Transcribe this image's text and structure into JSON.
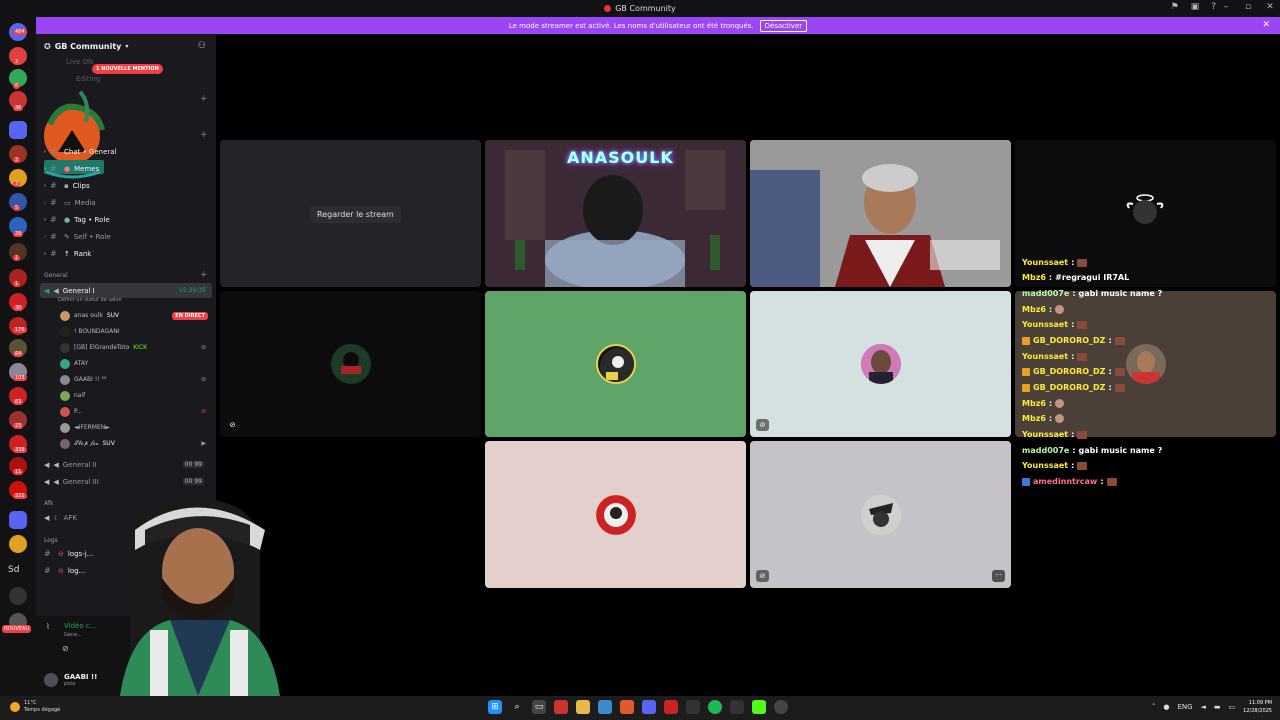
{
  "window": {
    "title": "GB Community"
  },
  "banner": {
    "message": "Le mode streamer est activé. Les noms d'utilisateur ont été tronqués.",
    "button": "Désactiver"
  },
  "rail": {
    "badges": [
      "484",
      "2",
      "6",
      "36",
      "2",
      "3",
      "5",
      "29",
      "1",
      "1",
      "30",
      "176",
      "64",
      "103",
      "63",
      "23",
      "338",
      "11",
      "221"
    ],
    "sd_label": "Sd",
    "nouveau_label": "NOUVEAU"
  },
  "server": {
    "name": "GB Community",
    "mention_label": "1 NOUVELLE MENTION",
    "hidden_channels": [
      "Live ON",
      "Editing"
    ]
  },
  "channels": [
    {
      "label": "Chat • General",
      "icon": "#"
    },
    {
      "label": "Memes",
      "icon": "#"
    },
    {
      "label": "Clips",
      "icon": "#"
    },
    {
      "label": "Media",
      "icon": "#"
    },
    {
      "label": "Tag • Role",
      "icon": "#"
    },
    {
      "label": "Self • Role",
      "icon": "#"
    },
    {
      "label": "Rank",
      "icon": "#"
    }
  ],
  "categories": {
    "general": "General",
    "afk": "Afk",
    "logs": "Logs"
  },
  "voice": {
    "general1": {
      "label": "General I",
      "time": "15:29:35",
      "status": "Définir un statut de salon"
    },
    "users": [
      {
        "name": "anas oulk",
        "tag": "SUV",
        "live": "EN DIRECT"
      },
      {
        "name": "! BOUNDAGANI",
        "tag": ""
      },
      {
        "name": "[GB] ElGrandeToto",
        "tag": "KICK"
      },
      {
        "name": "ATAY",
        "tag": ""
      },
      {
        "name": "GAABI !! ²⁵",
        "tag": ""
      },
      {
        "name": "naif",
        "tag": ""
      },
      {
        "name": "P...",
        "tag": ""
      },
      {
        "name": "◄IFERMEN►",
        "tag": ""
      },
      {
        "name": "𝓢𝓽𝓸𝓹 𝓯𝓲𝔁",
        "tag": "SUV"
      }
    ],
    "general2": {
      "label": "General II",
      "count_a": "00",
      "count_b": "99"
    },
    "general3": {
      "label": "General III",
      "count_a": "00",
      "count_b": "99"
    },
    "afk": {
      "label": "AFK"
    },
    "logs": [
      "logs-j...",
      "log..."
    ]
  },
  "voice_connected": {
    "title": "Vidéo c...",
    "subtitle": "Gene..."
  },
  "user_panel": {
    "name": "GAABI !!",
    "status": "poto"
  },
  "stage": {
    "watch_label": "Regarder le stream",
    "stream_name": "ANASOULK"
  },
  "chat": [
    {
      "user": "Mbz6",
      "text": "#regragui IR7AL",
      "class": "u"
    },
    {
      "user": "madd007e",
      "text": "gabi music name ?",
      "class": "u2"
    },
    {
      "user": "Mbz6",
      "text": "",
      "class": "u"
    },
    {
      "user": "Younssaet",
      "text": "",
      "class": "u"
    },
    {
      "user": "GB_DORORO_DZ",
      "text": "",
      "class": "u"
    },
    {
      "user": "Younssaet",
      "text": "",
      "class": "u"
    },
    {
      "user": "GB_DORORO_DZ",
      "text": "",
      "class": "u"
    },
    {
      "user": "GB_DORORO_DZ",
      "text": "",
      "class": "u"
    },
    {
      "user": "Mbz6",
      "text": "",
      "class": "u"
    },
    {
      "user": "Mbz6",
      "text": "",
      "class": "u"
    },
    {
      "user": "Younssaet",
      "text": "",
      "class": "u"
    },
    {
      "user": "madd007e",
      "text": "gabi music name ?",
      "class": "u2"
    },
    {
      "user": "Younssaet",
      "text": "",
      "class": "u"
    },
    {
      "user": "amedinntrcaw",
      "text": "",
      "class": "u3"
    }
  ],
  "chat_top": {
    "user": "Younssaet"
  },
  "taskbar": {
    "temp": "11°C",
    "weather": "Temps dégagé",
    "lang": "ENG",
    "time": "11:09 PM",
    "date": "12/28/2025"
  }
}
